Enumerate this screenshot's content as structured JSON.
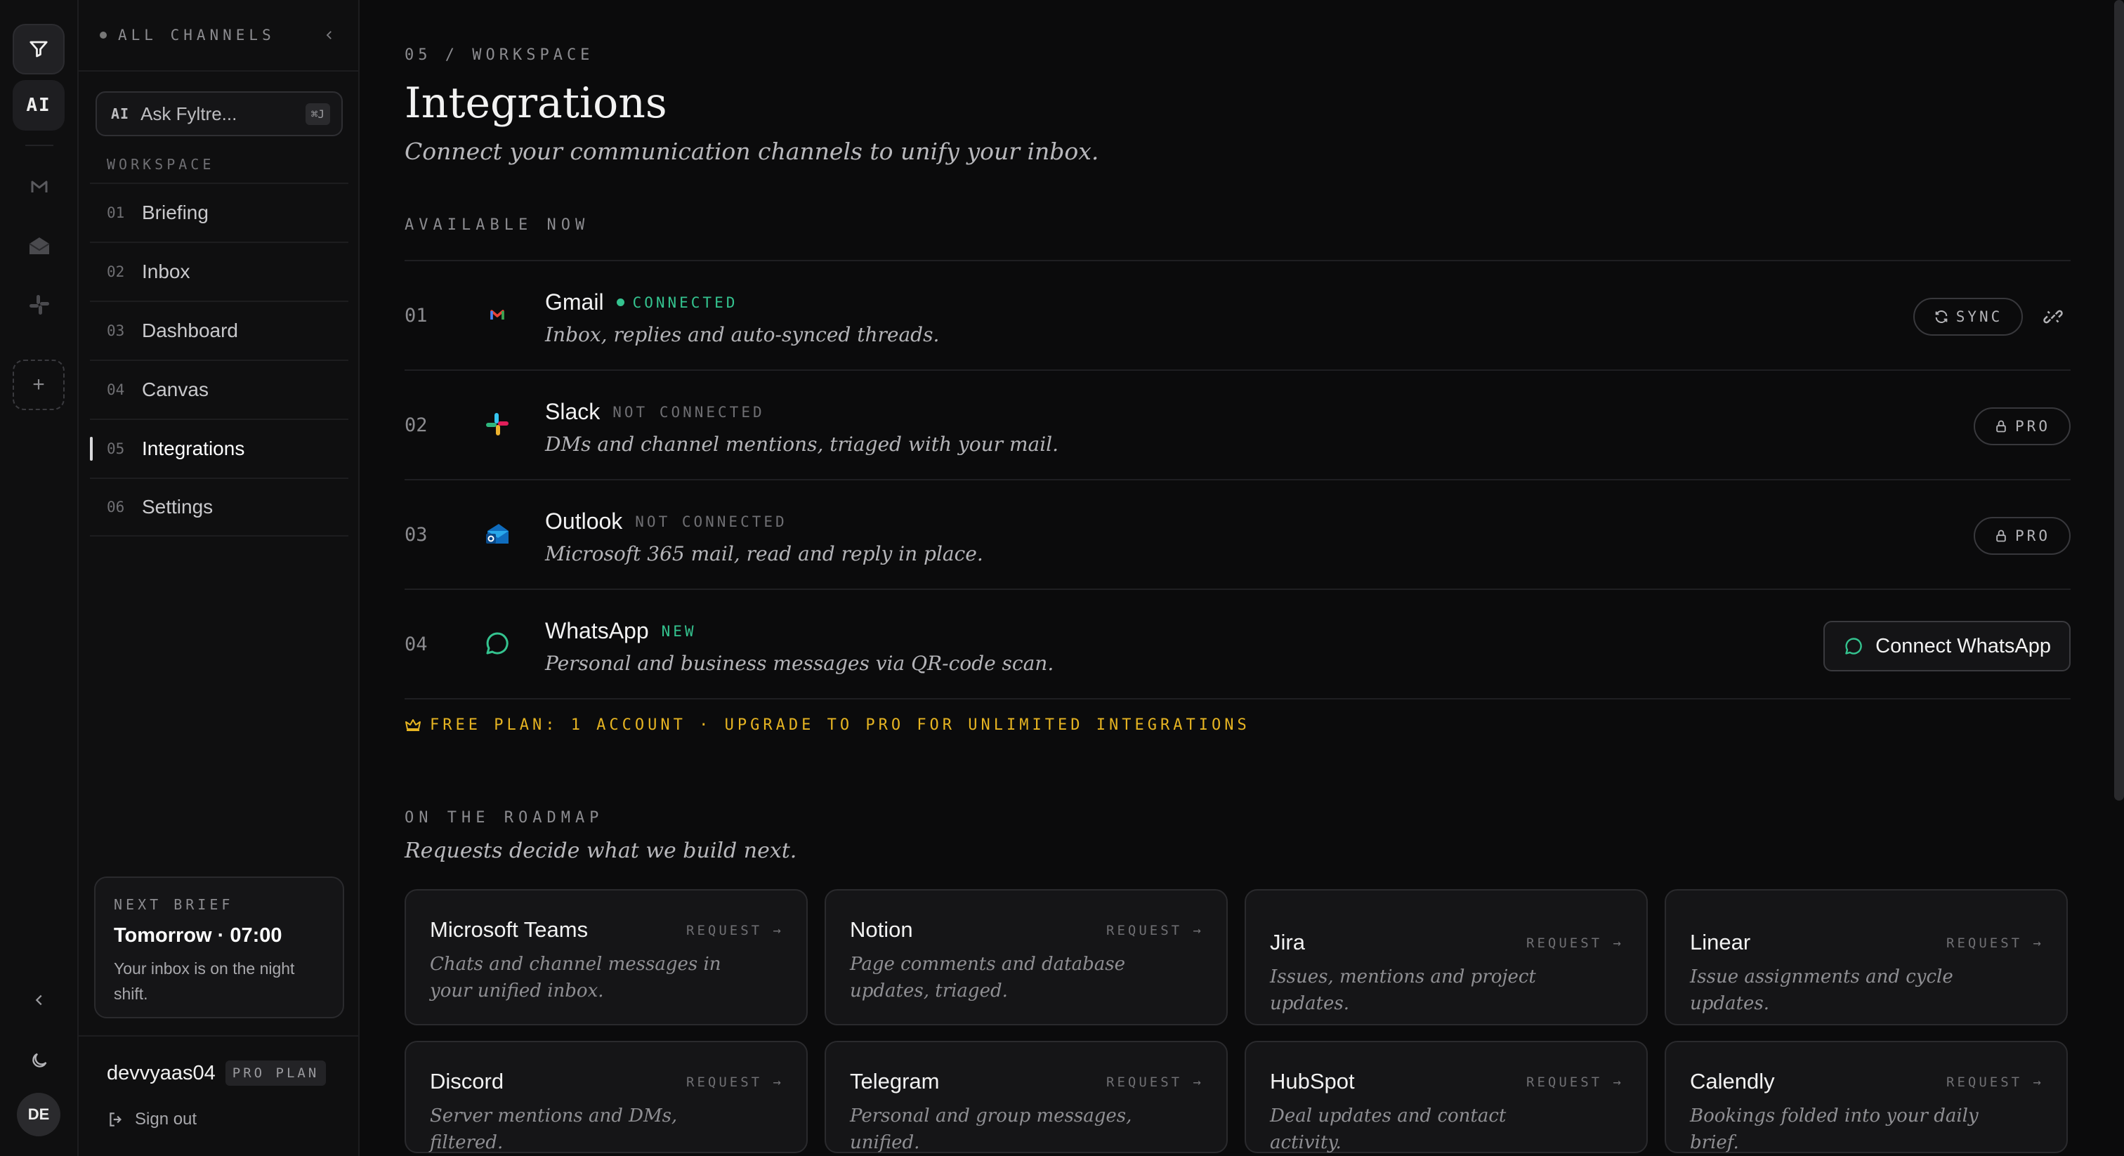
{
  "rail": {
    "ai_label": "AI",
    "avatar_initials": "DE"
  },
  "sidebar": {
    "header_label": "ALL CHANNELS",
    "ask": {
      "tag": "AI",
      "placeholder": "Ask Fyltre...",
      "shortcut": "⌘J"
    },
    "section_label": "WORKSPACE",
    "nav": [
      {
        "num": "01",
        "label": "Briefing"
      },
      {
        "num": "02",
        "label": "Inbox"
      },
      {
        "num": "03",
        "label": "Dashboard"
      },
      {
        "num": "04",
        "label": "Canvas"
      },
      {
        "num": "05",
        "label": "Integrations",
        "active": true
      },
      {
        "num": "06",
        "label": "Settings"
      }
    ],
    "brief": {
      "kicker": "NEXT BRIEF",
      "time": "Tomorrow · 07:00",
      "desc": "Your inbox is on the night shift."
    },
    "user": {
      "name": "devvyaas04",
      "plan": "PRO PLAN",
      "signout": "Sign out"
    }
  },
  "main": {
    "breadcrumb": "05 / WORKSPACE",
    "title": "Integrations",
    "subtitle": "Connect your communication channels to unify your inbox.",
    "available_label": "AVAILABLE NOW",
    "integrations": [
      {
        "num": "01",
        "name": "Gmail",
        "status": "CONNECTED",
        "desc": "Inbox, replies and auto-synced threads.",
        "action": "SYNC"
      },
      {
        "num": "02",
        "name": "Slack",
        "status": "NOT CONNECTED",
        "desc": "DMs and channel mentions, triaged with your mail.",
        "action": "PRO"
      },
      {
        "num": "03",
        "name": "Outlook",
        "status": "NOT CONNECTED",
        "desc": "Microsoft 365 mail, read and reply in place.",
        "action": "PRO"
      },
      {
        "num": "04",
        "name": "WhatsApp",
        "status": "NEW",
        "desc": "Personal and business messages via QR-code scan.",
        "action": "Connect WhatsApp"
      }
    ],
    "free_plan_note": "FREE PLAN: 1 ACCOUNT · UPGRADE TO PRO FOR UNLIMITED INTEGRATIONS",
    "roadmap_label": "ON THE ROADMAP",
    "roadmap_sub": "Requests decide what we build next.",
    "request_label": "REQUEST →",
    "roadmap": [
      {
        "name": "Microsoft Teams",
        "desc": "Chats and channel messages in your unified inbox."
      },
      {
        "name": "Notion",
        "desc": "Page comments and database updates, triaged."
      },
      {
        "name": "Jira",
        "desc": "Issues, mentions and project updates."
      },
      {
        "name": "Linear",
        "desc": "Issue assignments and cycle updates."
      },
      {
        "name": "Discord",
        "desc": "Server mentions and DMs, filtered."
      },
      {
        "name": "Telegram",
        "desc": "Personal and group messages, unified."
      },
      {
        "name": "HubSpot",
        "desc": "Deal updates and contact activity."
      },
      {
        "name": "Calendly",
        "desc": "Bookings folded into your daily brief."
      }
    ]
  },
  "colors": {
    "accent_green": "#34c38f",
    "accent_gold": "#e6b422",
    "background": "#0b0b0c"
  }
}
